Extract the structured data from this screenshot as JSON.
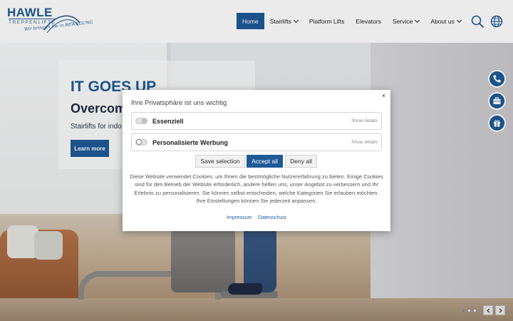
{
  "brand": {
    "name": "HAWLE",
    "subname": "TREPPENLIFTE",
    "slogan": "Wir bringen Sie in BEWEGUNG"
  },
  "nav": {
    "items": [
      {
        "label": "Home",
        "active": true,
        "dropdown": false
      },
      {
        "label": "Stairlifts",
        "active": false,
        "dropdown": true
      },
      {
        "label": "Platform Lifts",
        "active": false,
        "dropdown": false
      },
      {
        "label": "Elevators",
        "active": false,
        "dropdown": false
      },
      {
        "label": "Service",
        "active": false,
        "dropdown": true
      },
      {
        "label": "About us",
        "active": false,
        "dropdown": true
      }
    ],
    "icons": [
      "search-icon",
      "globe-icon"
    ]
  },
  "hero": {
    "title": "IT GOES UP",
    "subtitle": "Overcome",
    "text": "Stairlifts for indo",
    "button_label": "Learn more",
    "slider": {
      "slides": 3,
      "active_index": 0
    },
    "side_icons": [
      "phone-icon",
      "briefcase-icon",
      "gift-icon"
    ]
  },
  "cookie_modal": {
    "close_label": "×",
    "title": "Ihre Privatsphäre ist uns wichtig",
    "categories": [
      {
        "label": "Essenziell",
        "enabled": true,
        "details_label": "Show details"
      },
      {
        "label": "Personalisierte Werbung",
        "enabled": false,
        "details_label": "Show details"
      }
    ],
    "buttons": {
      "save": "Save selection",
      "accept": "Accept all",
      "deny": "Deny all"
    },
    "description": "Diese Website verwendet Cookies, um Ihnen die bestmögliche Nutzererfahrung zu bieten. Einige Cookies sind für den Betrieb der Website erforderlich, andere helfen uns, unser Angebot zu verbessern und Ihr Erlebnis zu personalisieren. Sie können selbst entscheiden, welche Kategorien Sie erlauben möchten. Ihre Einstellungen können Sie jederzeit anpassen.",
    "links": {
      "imprint": "Impressum",
      "separator": "·",
      "privacy": "Datenschutz"
    }
  },
  "colors": {
    "brand_blue": "#1e5a96",
    "text_dark": "#1c2c40"
  }
}
